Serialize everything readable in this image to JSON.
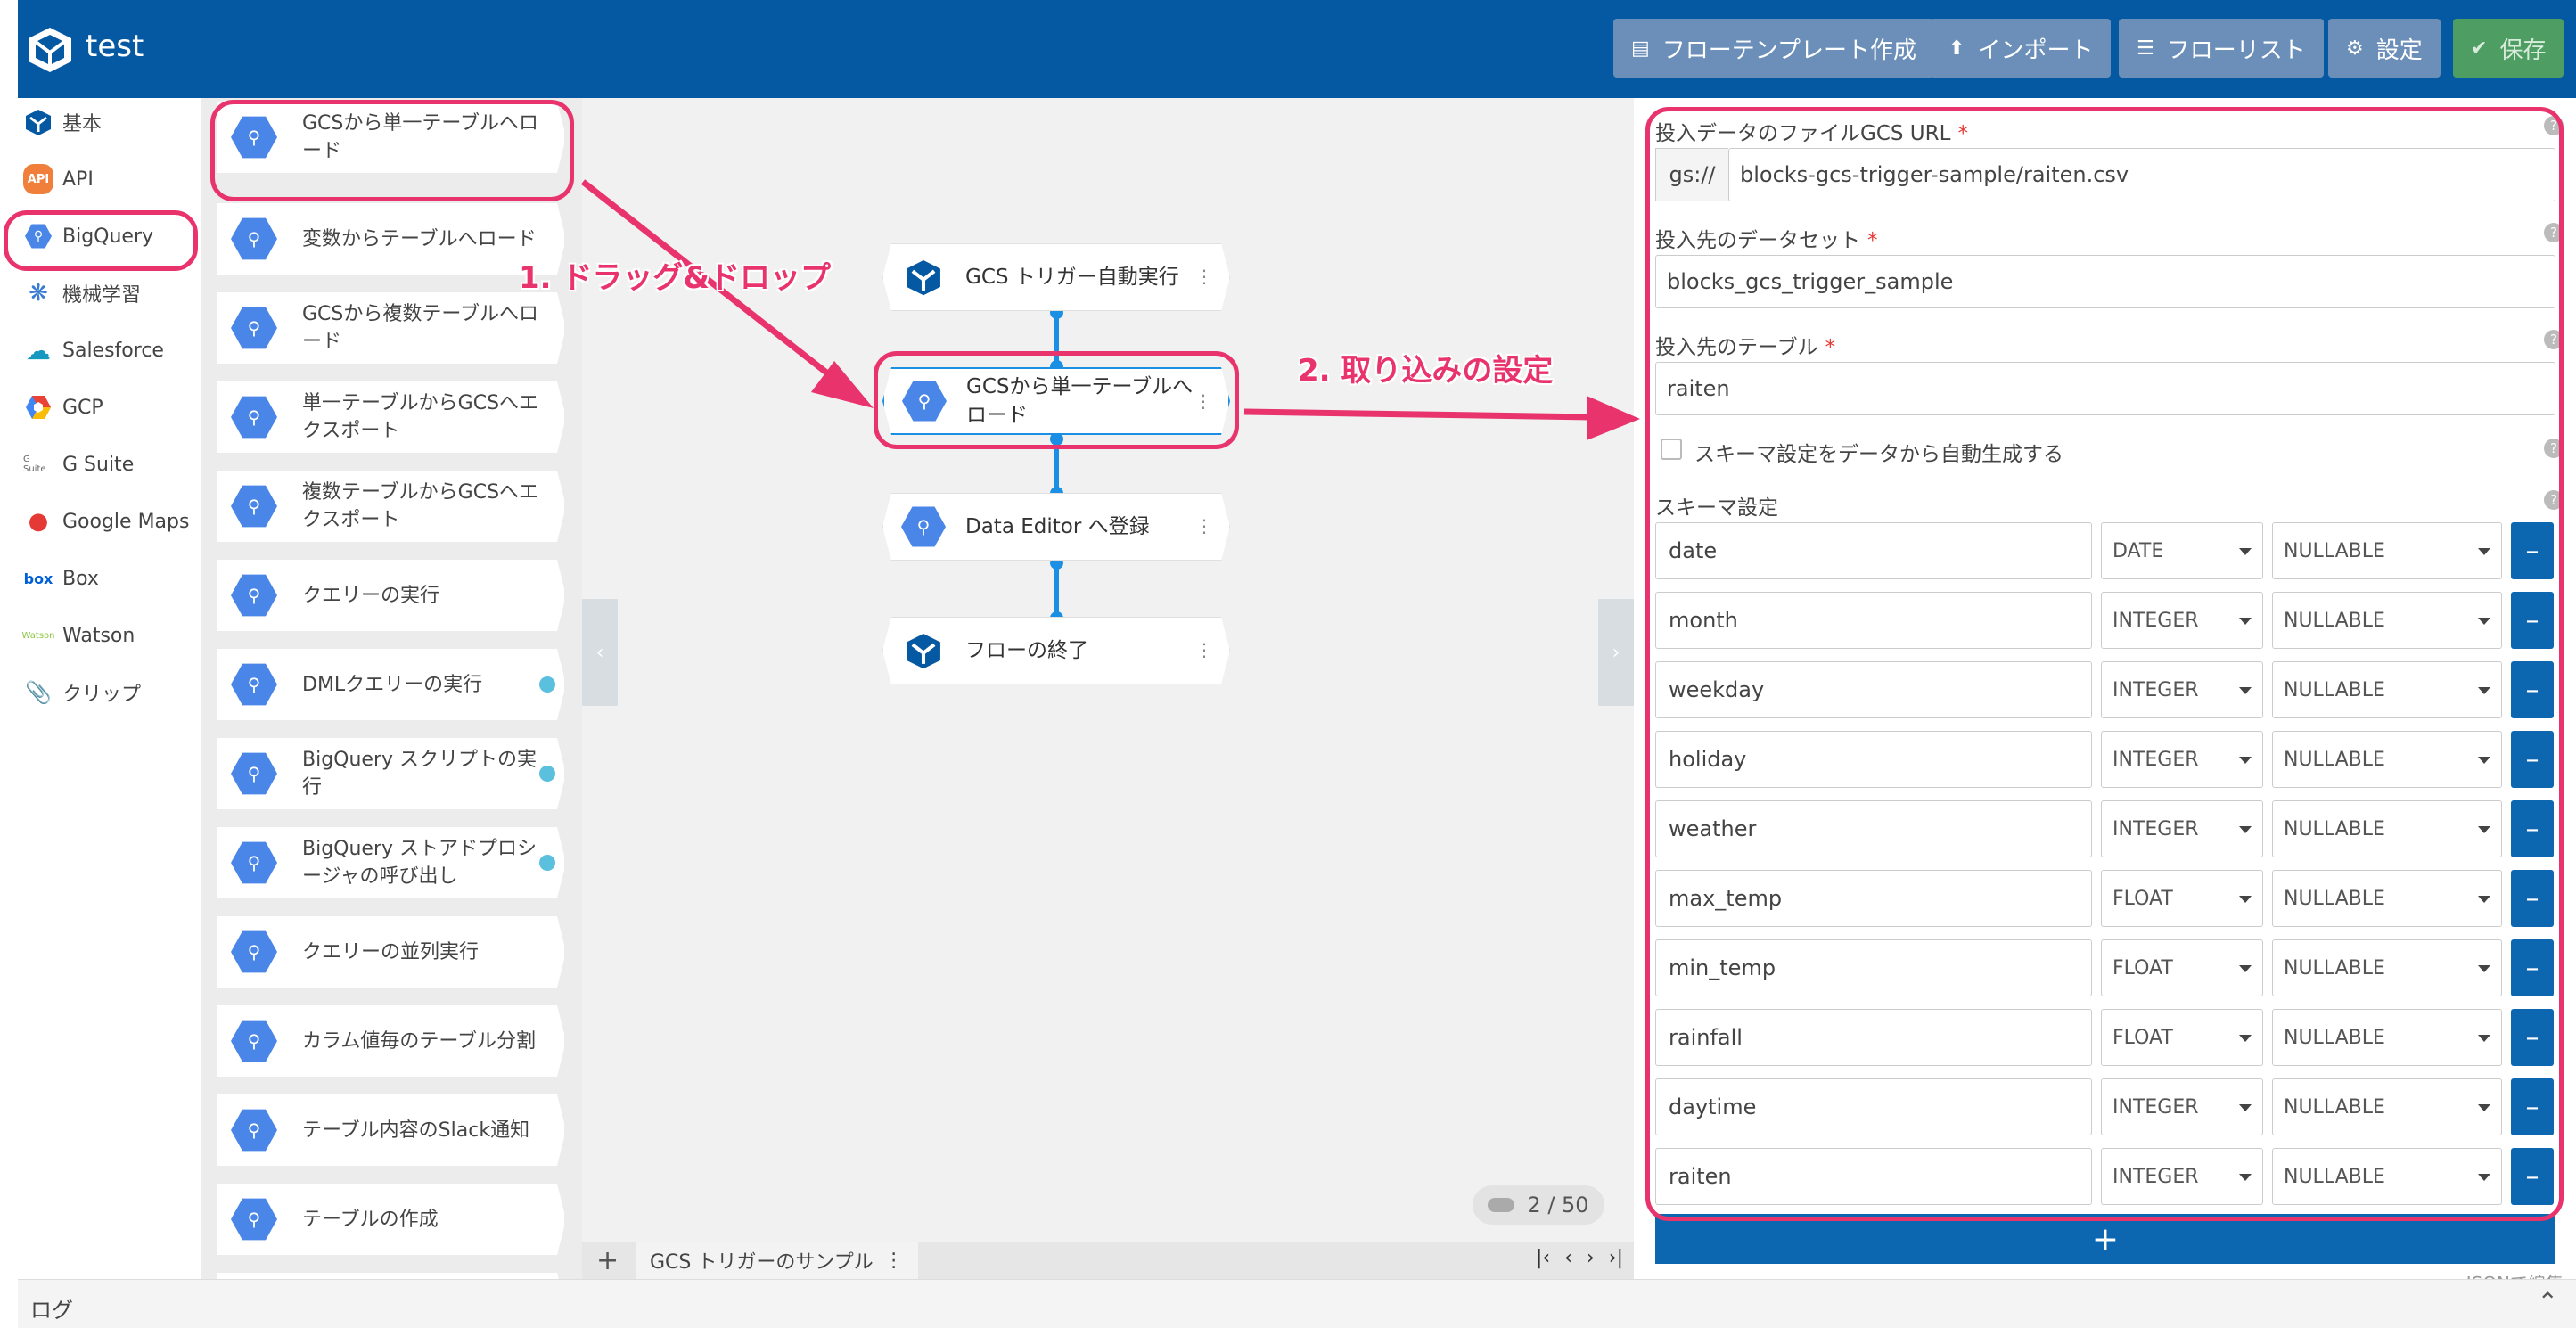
{
  "header": {
    "title": "test",
    "buttons": {
      "flow_template": "フローテンプレート作成",
      "import": "インポート",
      "flow_list": "フローリスト",
      "settings": "設定",
      "save": "保存"
    }
  },
  "categories": [
    {
      "label": "基本",
      "icon": "blocks-logo-icon"
    },
    {
      "label": "API",
      "icon": "api-icon"
    },
    {
      "label": "BigQuery",
      "icon": "bigquery-icon"
    },
    {
      "label": "機械学習",
      "icon": "brain-icon"
    },
    {
      "label": "Salesforce",
      "icon": "cloud-icon"
    },
    {
      "label": "GCP",
      "icon": "gcp-icon"
    },
    {
      "label": "G Suite",
      "icon": "gsuite-icon"
    },
    {
      "label": "Google Maps",
      "icon": "map-pin-icon"
    },
    {
      "label": "Box",
      "icon": "box-icon"
    },
    {
      "label": "Watson",
      "icon": "watson-icon"
    },
    {
      "label": "クリップ",
      "icon": "paperclip-icon"
    }
  ],
  "category_icon_text": {
    "api": "API",
    "box": "box",
    "gsuite": "G Suite",
    "watson": "Watson"
  },
  "palette": [
    {
      "label": "GCSから単一テーブルへロード",
      "badge": false
    },
    {
      "label": "変数からテーブルへロード",
      "badge": false
    },
    {
      "label": "GCSから複数テーブルへロード",
      "badge": false
    },
    {
      "label": "単一テーブルからGCSへエクスポート",
      "badge": false
    },
    {
      "label": "複数テーブルからGCSへエクスポート",
      "badge": false
    },
    {
      "label": "クエリーの実行",
      "badge": false
    },
    {
      "label": "DMLクエリーの実行",
      "badge": true
    },
    {
      "label": "BigQuery スクリプトの実行",
      "badge": true
    },
    {
      "label": "BigQuery ストアドプロシージャの呼び出し",
      "badge": true
    },
    {
      "label": "クエリーの並列実行",
      "badge": false
    },
    {
      "label": "カラム値毎のテーブル分割",
      "badge": false
    },
    {
      "label": "テーブル内容のSlack通知",
      "badge": false
    },
    {
      "label": "テーブルの作成",
      "badge": false
    }
  ],
  "flow": {
    "nodes": [
      {
        "label": "GCS トリガー自動実行",
        "icon": "blocks-logo-icon"
      },
      {
        "label": "GCSから単一テーブルへロード",
        "icon": "bigquery-icon"
      },
      {
        "label": "Data Editor へ登録",
        "icon": "bigquery-icon"
      },
      {
        "label": "フローの終了",
        "icon": "blocks-logo-icon"
      }
    ],
    "counter": "2 / 50",
    "tab_label": "GCS トリガーのサンプル"
  },
  "annotations": {
    "step1": "1. ドラッグ&ドロップ",
    "step2": "2. 取り込みの設定"
  },
  "properties": {
    "gcs_url_label": "投入データのファイルGCS URL",
    "gcs_prefix": "gs://",
    "gcs_url_value": "blocks-gcs-trigger-sample/raiten.csv",
    "dataset_label": "投入先のデータセット",
    "dataset_value": "blocks_gcs_trigger_sample",
    "table_label": "投入先のテーブル",
    "table_value": "raiten",
    "auto_schema_label": "スキーマ設定をデータから自動生成する",
    "schema_label": "スキーマ設定",
    "required_mark": "*",
    "help_mark": "?",
    "schema": [
      {
        "name": "date",
        "type": "DATE",
        "mode": "NULLABLE"
      },
      {
        "name": "month",
        "type": "INTEGER",
        "mode": "NULLABLE"
      },
      {
        "name": "weekday",
        "type": "INTEGER",
        "mode": "NULLABLE"
      },
      {
        "name": "holiday",
        "type": "INTEGER",
        "mode": "NULLABLE"
      },
      {
        "name": "weather",
        "type": "INTEGER",
        "mode": "NULLABLE"
      },
      {
        "name": "max_temp",
        "type": "FLOAT",
        "mode": "NULLABLE"
      },
      {
        "name": "min_temp",
        "type": "FLOAT",
        "mode": "NULLABLE"
      },
      {
        "name": "rainfall",
        "type": "FLOAT",
        "mode": "NULLABLE"
      },
      {
        "name": "daytime",
        "type": "INTEGER",
        "mode": "NULLABLE"
      },
      {
        "name": "raiten",
        "type": "INTEGER",
        "mode": "NULLABLE"
      }
    ],
    "add_row": "+",
    "json_edit": "JSONで編集"
  },
  "log": {
    "label": "ログ"
  },
  "colors": {
    "header": "#0459a2",
    "accent": "#0d66b0",
    "annotation": "#e8336d",
    "bigquery": "#4a86e8",
    "save": "#4e9d63"
  }
}
